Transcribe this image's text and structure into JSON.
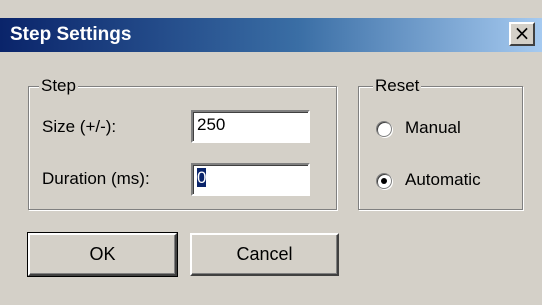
{
  "window": {
    "title": "Step Settings",
    "close_glyph": "×",
    "close_icon": "close-icon"
  },
  "step_group": {
    "legend": "Step",
    "size_label": "Size (+/-):",
    "size_value": "250",
    "duration_label": "Duration (ms):",
    "duration_value": "0"
  },
  "reset_group": {
    "legend": "Reset",
    "options": [
      {
        "label": "Manual",
        "selected": false
      },
      {
        "label": "Automatic",
        "selected": true
      }
    ]
  },
  "buttons": {
    "ok_label": "OK",
    "cancel_label": "Cancel"
  },
  "colors": {
    "title_gradient_start": "#0a246a",
    "title_gradient_end": "#a6caf0",
    "face": "#d4d0c8"
  }
}
